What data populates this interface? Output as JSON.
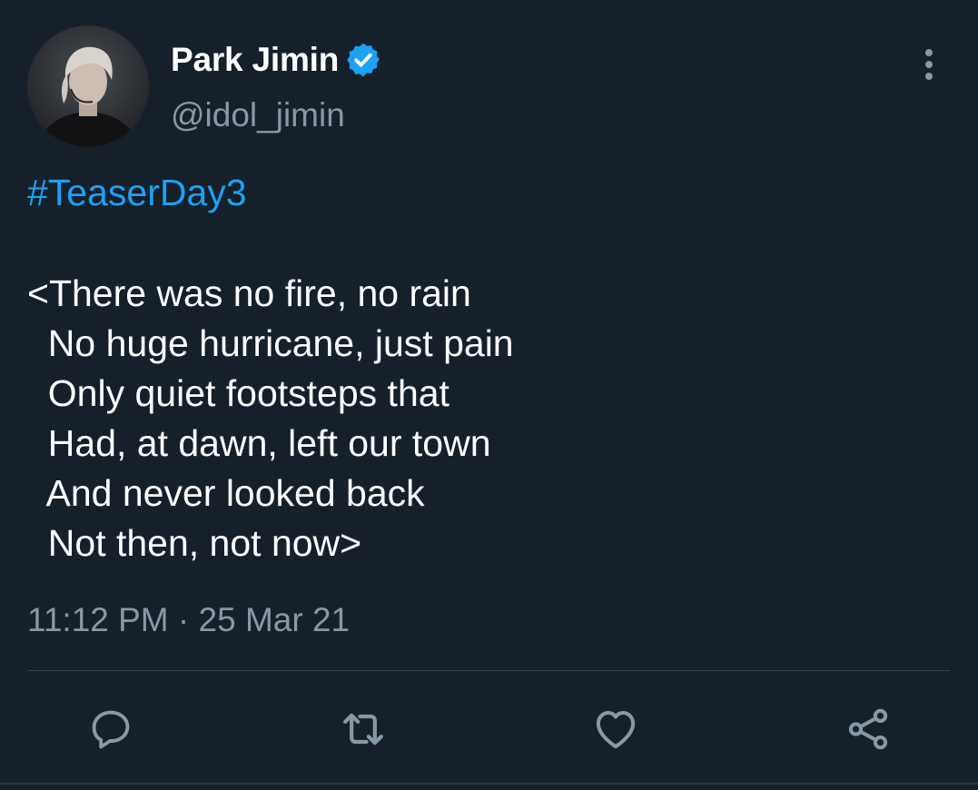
{
  "author": {
    "display_name": "Park Jimin",
    "handle": "@idol_jimin",
    "verified": true,
    "avatar_icon": "profile-photo"
  },
  "tweet": {
    "hashtag": "#TeaserDay3",
    "lines": [
      "<There was no fire, no rain",
      "  No huge hurricane, just pain",
      "  Only quiet footsteps that",
      "  Had, at dawn, left our town",
      "  And never looked back",
      "  Not then, not now>"
    ],
    "timestamp": "11:12 PM · 25 Mar 21"
  },
  "actions": [
    {
      "name": "reply",
      "icon": "reply-icon"
    },
    {
      "name": "retweet",
      "icon": "retweet-icon"
    },
    {
      "name": "like",
      "icon": "heart-icon"
    },
    {
      "name": "share",
      "icon": "share-icon"
    }
  ],
  "colors": {
    "background": "#15202b",
    "accent": "#1da1f2",
    "secondary_text": "#8899a6",
    "divider": "#38444d"
  }
}
